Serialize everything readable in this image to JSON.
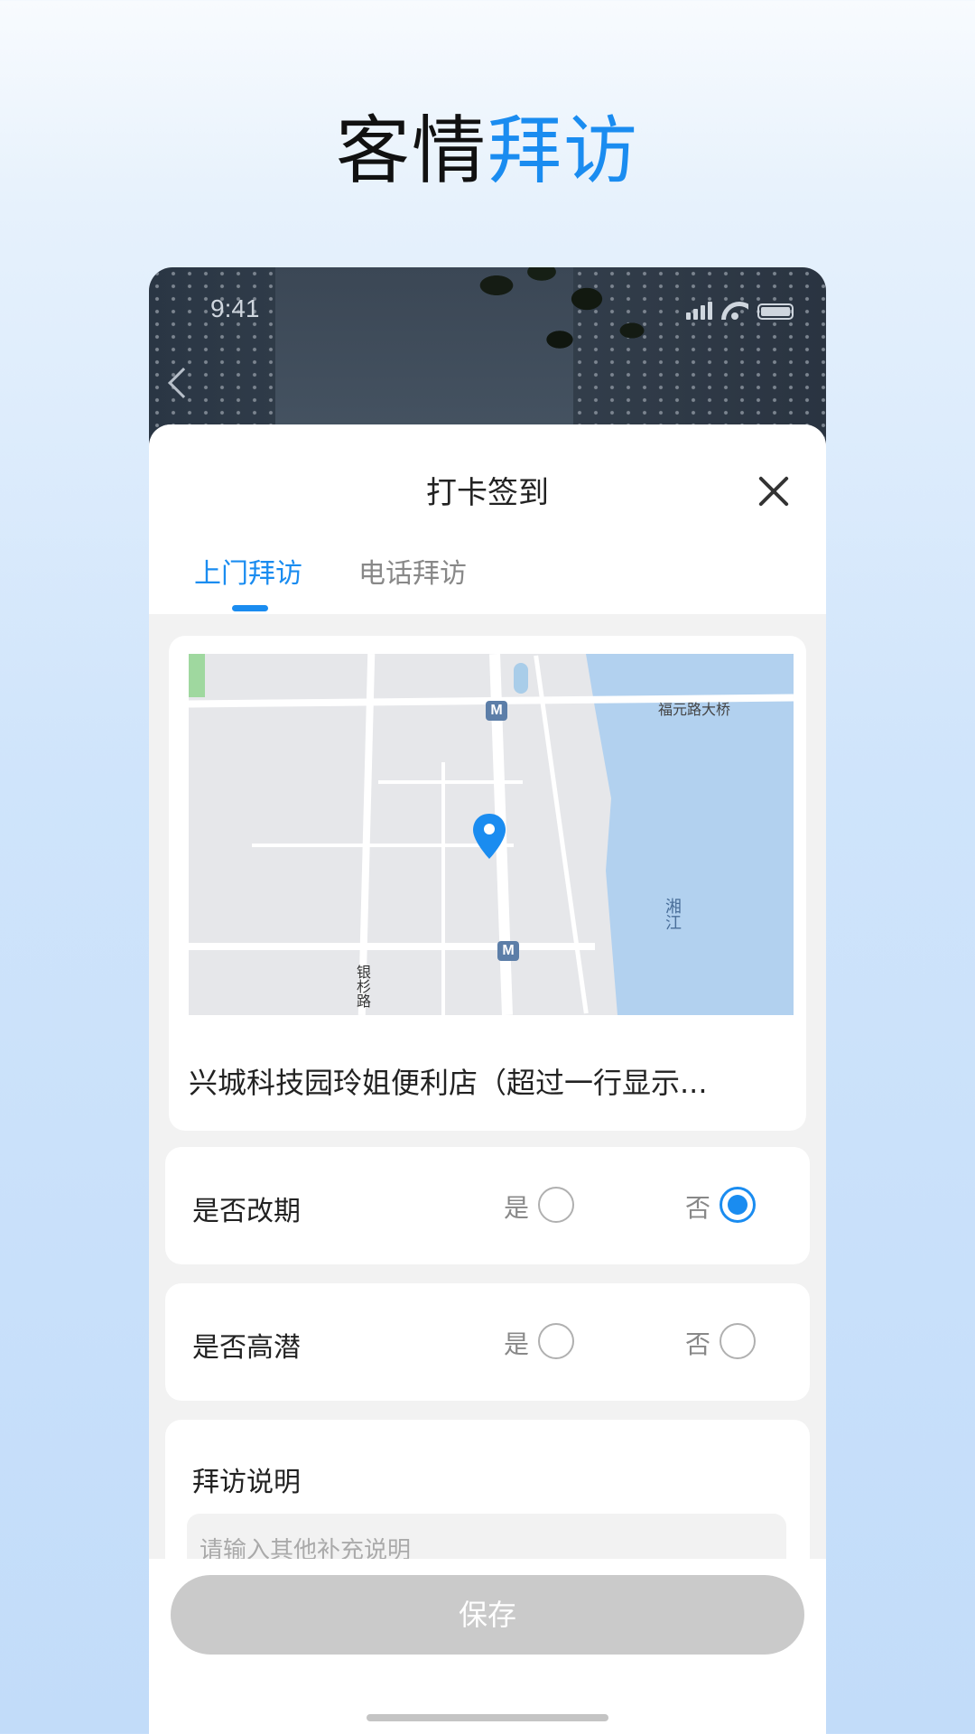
{
  "headline": {
    "part1": "客情",
    "part2": "拜访"
  },
  "phone": {
    "status_time": "9:41",
    "sheet": {
      "title": "打卡签到",
      "tabs": [
        {
          "label": "上门拜访",
          "active": true
        },
        {
          "label": "电话拜访",
          "active": false
        }
      ],
      "location": {
        "map_labels": {
          "bridge": "福元路大桥",
          "river": "湘江",
          "street": "银杉路",
          "metro_1": "M",
          "metro_2": "M"
        },
        "name": "兴城科技园玲姐便利店（超过一行显示..."
      },
      "questions": [
        {
          "label": "是否改期",
          "yes": "是",
          "no": "否",
          "selected": "no"
        },
        {
          "label": "是否高潜",
          "yes": "是",
          "no": "否",
          "selected": null
        }
      ],
      "note": {
        "label": "拜访说明",
        "placeholder": "请输入其他补充说明"
      },
      "save_label": "保存"
    }
  },
  "colors": {
    "accent": "#1a8cf0",
    "disabled_button": "#cacaca",
    "river": "#b2d1ef"
  }
}
